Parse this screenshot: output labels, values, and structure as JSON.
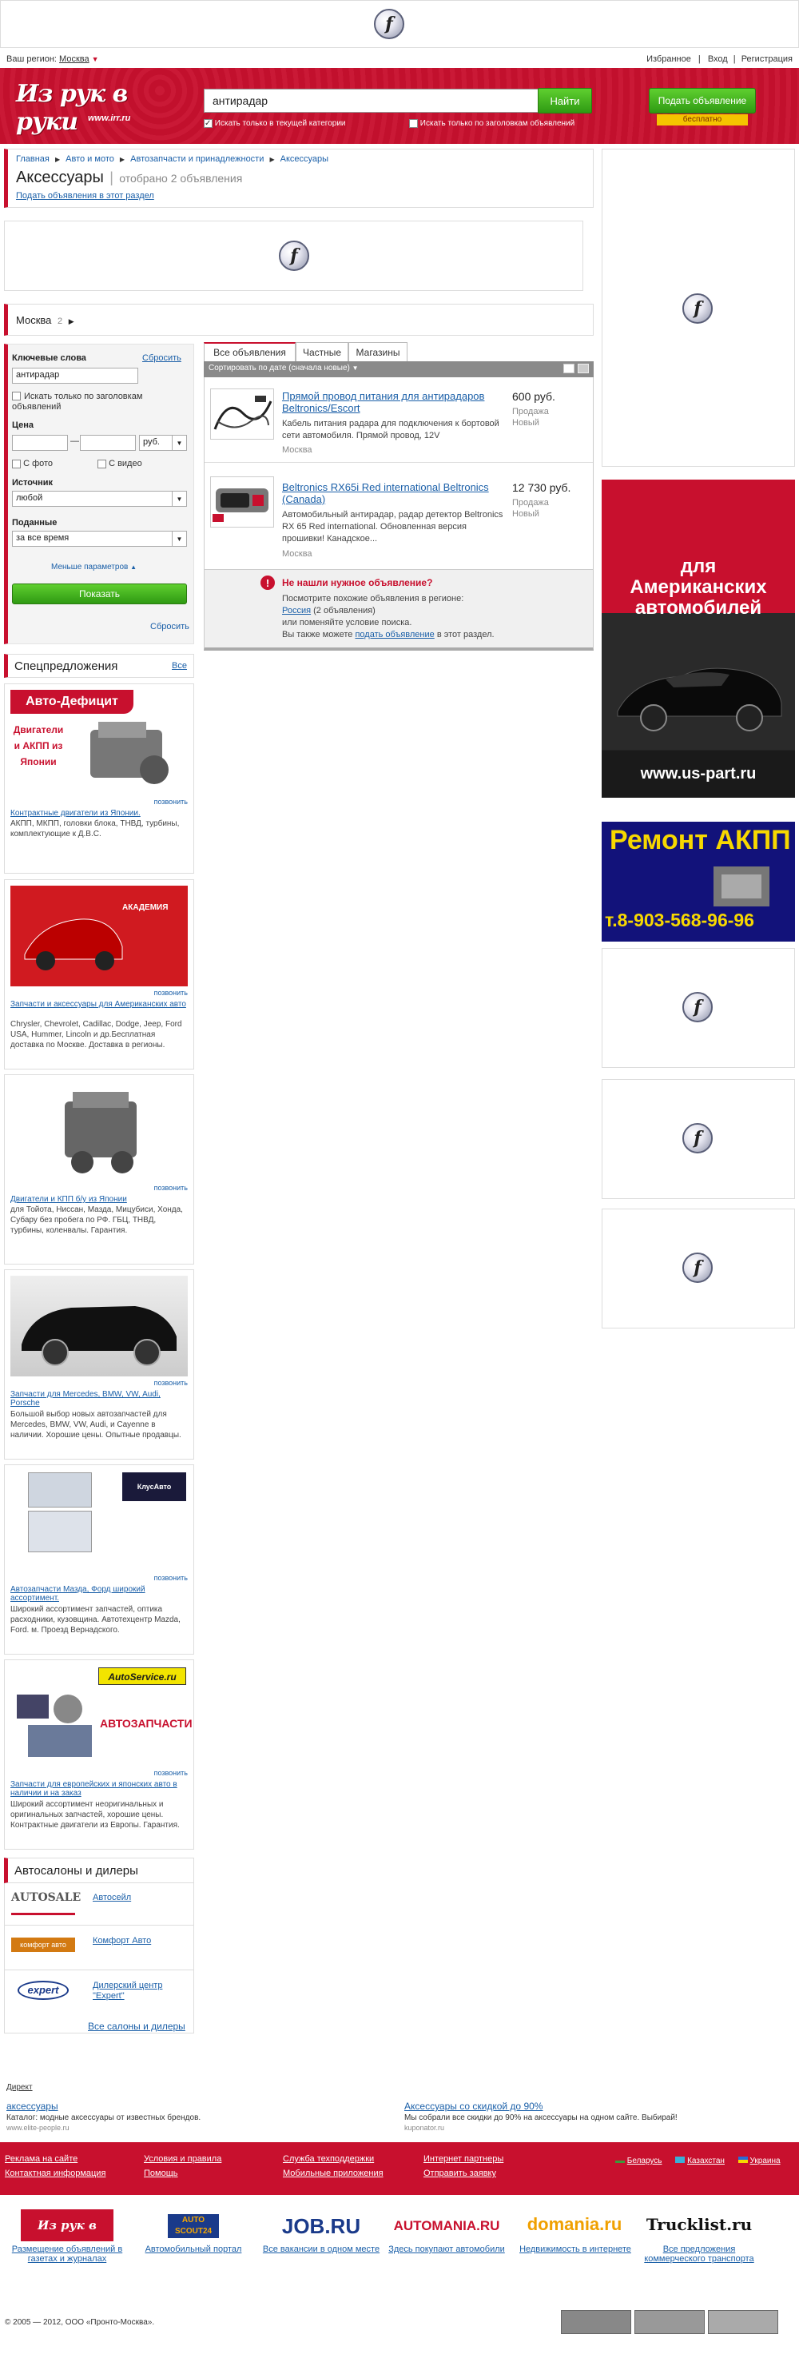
{
  "topbar": {
    "region_label": "Ваш регион:",
    "region_value": "Москва",
    "links": [
      "Избранное",
      "Вход",
      "Регистрация"
    ]
  },
  "header": {
    "logo": "Из рук в руки",
    "logo_sub": "www.irr.ru",
    "search_value": "антирадар",
    "find_button": "Найти",
    "chk_category": "Искать только в текущей категории",
    "chk_titles": "Искать только по заголовкам объявлений",
    "post_button": "Подать объявление",
    "post_free": "бесплатно"
  },
  "breadcrumb": {
    "items": [
      "Главная",
      "Авто и мото",
      "Автозапчасти и принадлежности",
      "Аксессуары"
    ],
    "title": "Аксессуары",
    "count": "отобрано 2 объявления",
    "post_link": "Подать объявления в этот раздел"
  },
  "location": {
    "city": "Москва",
    "count": "2"
  },
  "filters": {
    "keywords_label": "Ключевые слова",
    "reset_label": "Сбросить",
    "keywords_value": "антирадар",
    "titles_only": "Искать только по заголовкам объявлений",
    "price_label": "Цена",
    "price_dash": "—",
    "currency": "руб.",
    "with_photo": "С фото",
    "with_video": "С видео",
    "source_label": "Источник",
    "source_value": "любой",
    "submitted_label": "Поданные",
    "submitted_value": "за все время",
    "less_params": "Меньше параметров",
    "show_button": "Показать",
    "reset_bottom": "Сбросить"
  },
  "listing": {
    "tabs": [
      "Все объявления",
      "Частные",
      "Магазины"
    ],
    "sort_label": "Сортировать по дате (сначала новые)",
    "ads": [
      {
        "title": "Прямой провод питания для антирадаров Beltronics/Escort",
        "desc": "Кабель питания радара для подключения к бортовой сети автомобиля. Прямой провод, 12V",
        "city": "Москва",
        "price": "600 руб.",
        "type": "Продажа",
        "condition": "Новый"
      },
      {
        "title": "Beltronics RX65i Red international Beltronics (Canada)",
        "desc": "Автомобильный антирадар, радар детектор Beltronics RX 65 Red international. Обновленная версия прошивки! Канадское...",
        "city": "Москва",
        "price": "12 730 руб.",
        "type": "Продажа",
        "condition": "Новый"
      }
    ],
    "notfound": {
      "title": "Не нашли нужное объявление?",
      "line1": "Посмотрите похожие объявления в регионе:",
      "region_link": "Россия",
      "region_count": "(2 объявления)",
      "line2": "или поменяйте условие поиска.",
      "line3_pre": "Вы также можете",
      "line3_link": "подать объявление",
      "line3_post": "в этот раздел."
    }
  },
  "special": {
    "title": "Спецпредложения",
    "all": "Все",
    "call": "позвонить",
    "offers": [
      {
        "img_text": "Авто-Дефицит",
        "img_sub": "Двигатели и АКПП из Японии",
        "link": "Контрактные двигатели из Японии.",
        "text": "АКПП, МКПП, головки блока, ТНВД, турбины, комплектующие к Д.В.С."
      },
      {
        "img_text": "АКАДЕМИЯ",
        "img_sub": "",
        "link": "Запчасти и аксессуары для Американских авто",
        "text": "Chrysler, Chevrolet, Cadillac, Dodge, Jeep, Ford USA, Hummer, Lincoln и др.Бесплатная доставка по Москве. Доставка в регионы."
      },
      {
        "img_text": "",
        "img_sub": "",
        "link": "Двигатели и КПП б/у из Японии",
        "text": "для Тойота, Ниссан, Мазда, Мицубиси, Хонда, Субару без пробега по РФ. ГБЦ, ТНВД, турбины, коленвалы. Гарантия."
      },
      {
        "img_text": "",
        "img_sub": "",
        "link": "Запчасти для Mercedes, BMW, VW, Audi, Porsche",
        "text": "Большой выбор новых автозапчастей для Mercedes, BMW, VW, Audi, и Cayenne в наличии. Хорошие цены. Опытные продавцы."
      },
      {
        "img_text": "КлусАвто",
        "img_sub": "",
        "link": "Автозапчасти Мазда, Форд широкий ассортимент.",
        "text": "Широкий ассортимент запчастей, оптика расходники, кузовщина. Автотехцентр Mazda, Ford. м. Проезд Вернадского."
      },
      {
        "img_text": "АВТОЗАПЧАСТИ",
        "img_sub": "AutoService.ru",
        "link": "Запчасти для европейских и японских авто в наличии и на заказ",
        "text": "Широкий ассортимент неоригинальных и оригинальных запчастей, хорошие цены. Контрактные двигатели из Европы. Гарантия."
      }
    ]
  },
  "dealers": {
    "title": "Автосалоны и дилеры",
    "items": [
      {
        "logo": "AUTOSALE",
        "name": "Автосейл"
      },
      {
        "logo": "комфорт авто",
        "name": "Комфорт Авто"
      },
      {
        "logo": "expert",
        "name": "Дилерский центр \"Expert\""
      }
    ],
    "all_link": "Все салоны и дилеры"
  },
  "right_ads": {
    "us_part_title": "для Американских автомобилей",
    "us_part_url": "www.us-part.ru",
    "akpp_title": "Ремонт АКПП",
    "akpp_phone": "т.8-903-568-96-96"
  },
  "direct": {
    "label": "Директ",
    "items": [
      {
        "title": "аксессуары",
        "text": "Каталог: модные аксессуары от известных брендов.",
        "url": "www.elite-people.ru"
      },
      {
        "title": "Аксессуары со скидкой до 90%",
        "text": "Мы собрали все скидки до 90% на аксессуары на одном сайте. Выбирай!",
        "url": "kuponator.ru"
      }
    ]
  },
  "footer": {
    "col1": [
      "Реклама на сайте",
      "Контактная информация"
    ],
    "col2": [
      "Условия и правила",
      "Помощь"
    ],
    "col3": [
      "Служба техподдержки",
      "Мобильные приложения"
    ],
    "col4": [
      "Интернет партнеры",
      "Отправить заявку"
    ],
    "countries": [
      "Беларусь",
      "Казахстан",
      "Украина"
    ],
    "partners": [
      {
        "logo": "Из рук в руки",
        "label": "Размещение объявлений в газетах и журналах"
      },
      {
        "logo": "AUTO SCOUT24",
        "label": "Автомобильный портал"
      },
      {
        "logo": "JOB.RU",
        "label": "Все вакансии в одном месте"
      },
      {
        "logo": "AUTOMANIA.RU",
        "label": "Здесь покупают автомобили"
      },
      {
        "logo": "domania.ru",
        "label": "Недвижимость в интернете"
      },
      {
        "logo": "Trucklist.ru",
        "label": "Все предложения коммерческого транспорта"
      }
    ],
    "copyright": "© 2005 — 2012, ООО «Пронто-Москва»."
  },
  "colors": {
    "brand_red": "#c8102e",
    "button_green": "#3aaa1a",
    "link_blue": "#1a5fa8"
  }
}
